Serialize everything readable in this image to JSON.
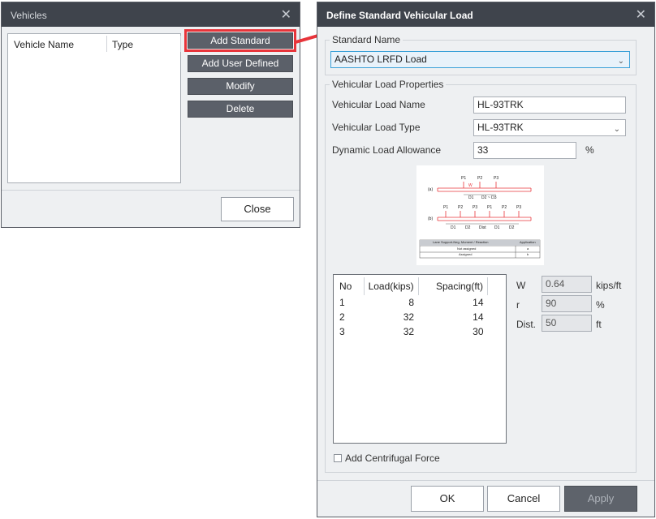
{
  "vehicles": {
    "title": "Vehicles",
    "columns": [
      "Vehicle Name",
      "Type"
    ],
    "buttons": {
      "add_standard": "Add Standard",
      "add_user_defined": "Add User Defined",
      "modify": "Modify",
      "delete": "Delete",
      "close": "Close"
    }
  },
  "define": {
    "title": "Define Standard Vehicular Load",
    "standard_name": {
      "legend": "Standard Name",
      "selected": "AASHTO LRFD Load"
    },
    "properties": {
      "legend": "Vehicular Load Properties",
      "name_label": "Vehicular Load Name",
      "name_value": "HL-93TRK",
      "type_label": "Vehicular Load Type",
      "type_value": "HL-93TRK",
      "dla_label": "Dynamic Load Allowance",
      "dla_value": "33",
      "dla_unit": "%"
    },
    "diagram": {
      "a_label": "(a)",
      "b_label": "(b)",
      "axles_a": [
        "P1",
        "P2",
        "P3"
      ],
      "axles_b": [
        "P1",
        "P2",
        "P3",
        "P1",
        "P2",
        "P3"
      ],
      "w_label": "W",
      "dims_a": [
        "D1",
        "D2 ~ D3"
      ],
      "dims_b": [
        "D1",
        "D2",
        "Dist",
        "D1",
        "D2"
      ],
      "table_header": [
        "Lane Support-Neg. Moment / Reaction",
        "Application"
      ],
      "table_rows": [
        [
          "Not assigned",
          "a"
        ],
        [
          "Assigned",
          "b"
        ]
      ]
    },
    "load_table": {
      "headers": [
        "No",
        "Load(kips)",
        "Spacing(ft)"
      ],
      "rows": [
        [
          "1",
          "8",
          "14"
        ],
        [
          "2",
          "32",
          "14"
        ],
        [
          "3",
          "32",
          "30"
        ]
      ]
    },
    "side": {
      "w_label": "W",
      "w_value": "0.64",
      "w_unit": "kips/ft",
      "r_label": "r",
      "r_value": "90",
      "r_unit": "%",
      "dist_label": "Dist.",
      "dist_value": "50",
      "dist_unit": "ft"
    },
    "centrifugal_label": "Add Centrifugal Force",
    "buttons": {
      "ok": "OK",
      "cancel": "Cancel",
      "apply": "Apply"
    }
  },
  "colors": {
    "highlight": "#e8343a",
    "titlebar": "#3f444c",
    "button_dark": "#5b6069"
  }
}
